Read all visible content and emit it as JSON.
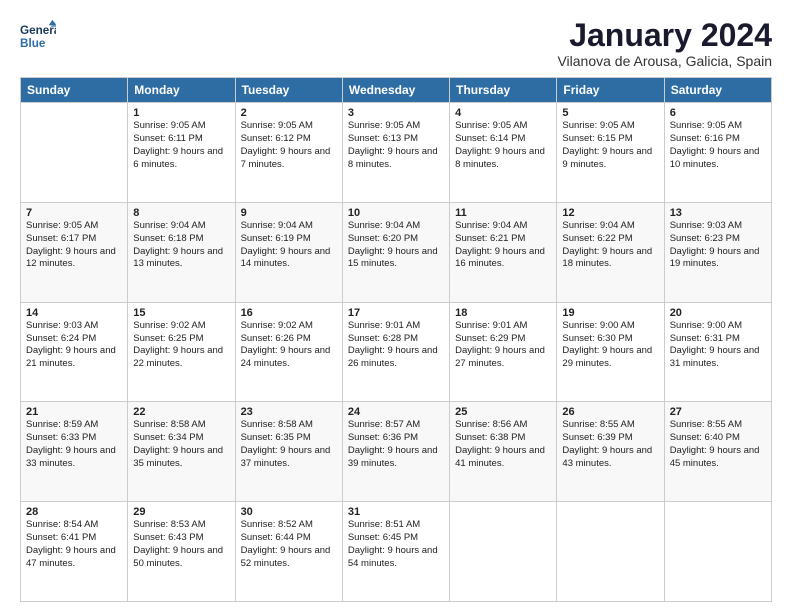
{
  "header": {
    "logo_line1": "General",
    "logo_line2": "Blue",
    "title": "January 2024",
    "subtitle": "Vilanova de Arousa, Galicia, Spain"
  },
  "days_of_week": [
    "Sunday",
    "Monday",
    "Tuesday",
    "Wednesday",
    "Thursday",
    "Friday",
    "Saturday"
  ],
  "weeks": [
    [
      {
        "day": "",
        "sunrise": "",
        "sunset": "",
        "daylight": ""
      },
      {
        "day": "1",
        "sunrise": "9:05 AM",
        "sunset": "6:11 PM",
        "daylight": "9 hours and 6 minutes."
      },
      {
        "day": "2",
        "sunrise": "9:05 AM",
        "sunset": "6:12 PM",
        "daylight": "9 hours and 7 minutes."
      },
      {
        "day": "3",
        "sunrise": "9:05 AM",
        "sunset": "6:13 PM",
        "daylight": "9 hours and 8 minutes."
      },
      {
        "day": "4",
        "sunrise": "9:05 AM",
        "sunset": "6:14 PM",
        "daylight": "9 hours and 8 minutes."
      },
      {
        "day": "5",
        "sunrise": "9:05 AM",
        "sunset": "6:15 PM",
        "daylight": "9 hours and 9 minutes."
      },
      {
        "day": "6",
        "sunrise": "9:05 AM",
        "sunset": "6:16 PM",
        "daylight": "9 hours and 10 minutes."
      }
    ],
    [
      {
        "day": "7",
        "sunrise": "9:05 AM",
        "sunset": "6:17 PM",
        "daylight": "9 hours and 12 minutes."
      },
      {
        "day": "8",
        "sunrise": "9:04 AM",
        "sunset": "6:18 PM",
        "daylight": "9 hours and 13 minutes."
      },
      {
        "day": "9",
        "sunrise": "9:04 AM",
        "sunset": "6:19 PM",
        "daylight": "9 hours and 14 minutes."
      },
      {
        "day": "10",
        "sunrise": "9:04 AM",
        "sunset": "6:20 PM",
        "daylight": "9 hours and 15 minutes."
      },
      {
        "day": "11",
        "sunrise": "9:04 AM",
        "sunset": "6:21 PM",
        "daylight": "9 hours and 16 minutes."
      },
      {
        "day": "12",
        "sunrise": "9:04 AM",
        "sunset": "6:22 PM",
        "daylight": "9 hours and 18 minutes."
      },
      {
        "day": "13",
        "sunrise": "9:03 AM",
        "sunset": "6:23 PM",
        "daylight": "9 hours and 19 minutes."
      }
    ],
    [
      {
        "day": "14",
        "sunrise": "9:03 AM",
        "sunset": "6:24 PM",
        "daylight": "9 hours and 21 minutes."
      },
      {
        "day": "15",
        "sunrise": "9:02 AM",
        "sunset": "6:25 PM",
        "daylight": "9 hours and 22 minutes."
      },
      {
        "day": "16",
        "sunrise": "9:02 AM",
        "sunset": "6:26 PM",
        "daylight": "9 hours and 24 minutes."
      },
      {
        "day": "17",
        "sunrise": "9:01 AM",
        "sunset": "6:28 PM",
        "daylight": "9 hours and 26 minutes."
      },
      {
        "day": "18",
        "sunrise": "9:01 AM",
        "sunset": "6:29 PM",
        "daylight": "9 hours and 27 minutes."
      },
      {
        "day": "19",
        "sunrise": "9:00 AM",
        "sunset": "6:30 PM",
        "daylight": "9 hours and 29 minutes."
      },
      {
        "day": "20",
        "sunrise": "9:00 AM",
        "sunset": "6:31 PM",
        "daylight": "9 hours and 31 minutes."
      }
    ],
    [
      {
        "day": "21",
        "sunrise": "8:59 AM",
        "sunset": "6:33 PM",
        "daylight": "9 hours and 33 minutes."
      },
      {
        "day": "22",
        "sunrise": "8:58 AM",
        "sunset": "6:34 PM",
        "daylight": "9 hours and 35 minutes."
      },
      {
        "day": "23",
        "sunrise": "8:58 AM",
        "sunset": "6:35 PM",
        "daylight": "9 hours and 37 minutes."
      },
      {
        "day": "24",
        "sunrise": "8:57 AM",
        "sunset": "6:36 PM",
        "daylight": "9 hours and 39 minutes."
      },
      {
        "day": "25",
        "sunrise": "8:56 AM",
        "sunset": "6:38 PM",
        "daylight": "9 hours and 41 minutes."
      },
      {
        "day": "26",
        "sunrise": "8:55 AM",
        "sunset": "6:39 PM",
        "daylight": "9 hours and 43 minutes."
      },
      {
        "day": "27",
        "sunrise": "8:55 AM",
        "sunset": "6:40 PM",
        "daylight": "9 hours and 45 minutes."
      }
    ],
    [
      {
        "day": "28",
        "sunrise": "8:54 AM",
        "sunset": "6:41 PM",
        "daylight": "9 hours and 47 minutes."
      },
      {
        "day": "29",
        "sunrise": "8:53 AM",
        "sunset": "6:43 PM",
        "daylight": "9 hours and 50 minutes."
      },
      {
        "day": "30",
        "sunrise": "8:52 AM",
        "sunset": "6:44 PM",
        "daylight": "9 hours and 52 minutes."
      },
      {
        "day": "31",
        "sunrise": "8:51 AM",
        "sunset": "6:45 PM",
        "daylight": "9 hours and 54 minutes."
      },
      {
        "day": "",
        "sunrise": "",
        "sunset": "",
        "daylight": ""
      },
      {
        "day": "",
        "sunrise": "",
        "sunset": "",
        "daylight": ""
      },
      {
        "day": "",
        "sunrise": "",
        "sunset": "",
        "daylight": ""
      }
    ]
  ]
}
